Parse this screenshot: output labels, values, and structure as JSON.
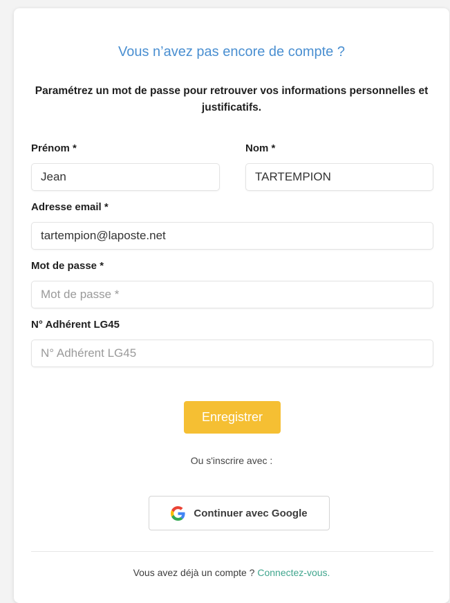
{
  "form": {
    "heading": "Vous n’avez pas encore de compte ?",
    "subtitle": "Paramétrez un mot de passe pour retrouver vos informations personnelles et justificatifs.",
    "fields": {
      "prenom": {
        "label": "Prénom *",
        "value": "Jean",
        "placeholder": "Prénom *"
      },
      "nom": {
        "label": "Nom *",
        "value": "TARTEMPION",
        "placeholder": "Nom *"
      },
      "email": {
        "label": "Adresse email *",
        "value": "tartempion@laposte.net",
        "placeholder": "Adresse email *"
      },
      "password": {
        "label": "Mot de passe *",
        "value": "",
        "placeholder": "Mot de passe *"
      },
      "adherent": {
        "label": "N° Adhérent LG45",
        "value": "",
        "placeholder": "N° Adhérent LG45"
      }
    },
    "submit_label": "Enregistrer",
    "or_text": "Ou s'inscrire avec :",
    "google_label": "Continuer avec Google",
    "footer_text": "Vous avez déjà un compte ?",
    "footer_link": "Connectez-vous."
  },
  "colors": {
    "heading": "#4a8fd1",
    "primary_button": "#f5bf33",
    "link": "#3fa58d"
  },
  "icons": {
    "google": "google-g-logo"
  }
}
